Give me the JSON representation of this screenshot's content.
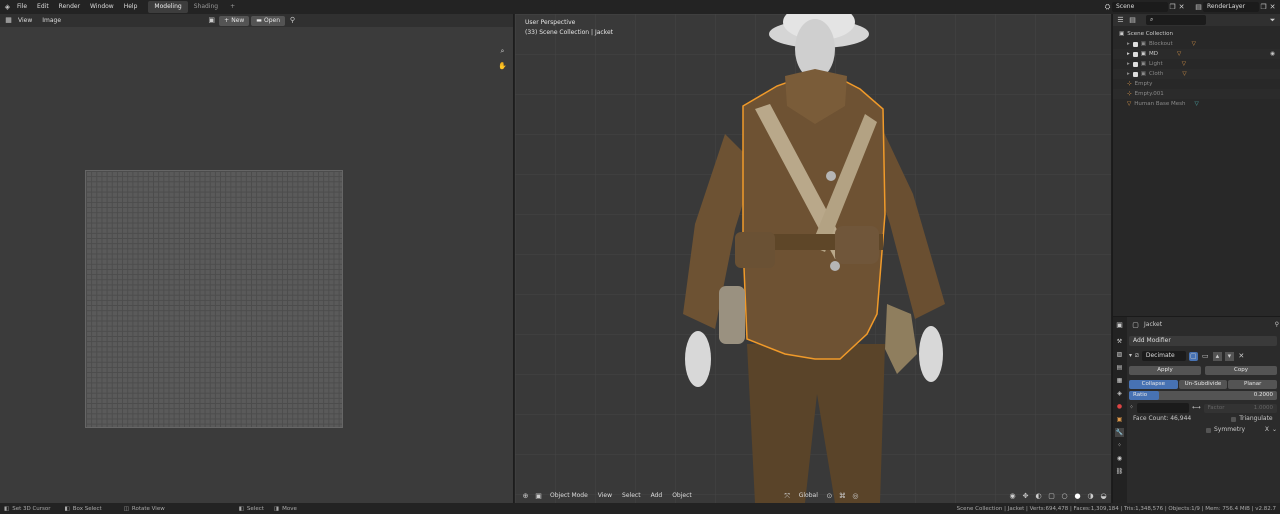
{
  "topbar": {
    "menus": [
      "File",
      "Edit",
      "Render",
      "Window",
      "Help"
    ],
    "workspaces": [
      "Modeling",
      "Shading"
    ],
    "active_workspace": "Modeling",
    "add_tab": "+",
    "scene": "Scene",
    "render_layer": "RenderLayer"
  },
  "image_editor": {
    "menus": [
      "View",
      "Image"
    ],
    "new_label": "New",
    "open_label": "Open"
  },
  "viewport": {
    "perspective": "User Perspective",
    "collection": "(33) Scene Collection | Jacket",
    "mode": "Object Mode",
    "menus": [
      "View",
      "Select",
      "Add",
      "Object"
    ],
    "orientation": "Global"
  },
  "outliner": {
    "root": "Scene Collection",
    "items": [
      {
        "name": "Blockout"
      },
      {
        "name": "MD"
      },
      {
        "name": "Light"
      },
      {
        "name": "Cloth"
      },
      {
        "name": "Empty"
      },
      {
        "name": "Empty.001"
      },
      {
        "name": "Human Base Mesh"
      }
    ]
  },
  "properties": {
    "object_name": "Jacket",
    "add_modifier": "Add Modifier",
    "modifier_name": "Decimate",
    "apply": "Apply",
    "copy": "Copy",
    "modes": [
      "Collapse",
      "Un-Subdivide",
      "Planar"
    ],
    "ratio_label": "Ratio",
    "ratio_value": "0.2000",
    "factor_label": "Factor",
    "factor_value": "1.0000",
    "triangulate": "Triangulate",
    "symmetry": "Symmetry",
    "symmetry_axis": "X",
    "face_count": "Face Count: 46,944"
  },
  "status": {
    "left": [
      "Set 3D Cursor",
      "Box Select",
      "Rotate View",
      "Select",
      "Move"
    ],
    "right": "Scene Collection | Jacket | Verts:694,478 | Faces:1,309,184 | Tris:1,348,576 | Objects:1/9 | Mem: 756.4 MiB | v2.82.7"
  },
  "colors": {
    "accent": "#4772b3",
    "selection_outline": "#f09a2a",
    "jacket": "#6b4f31"
  }
}
